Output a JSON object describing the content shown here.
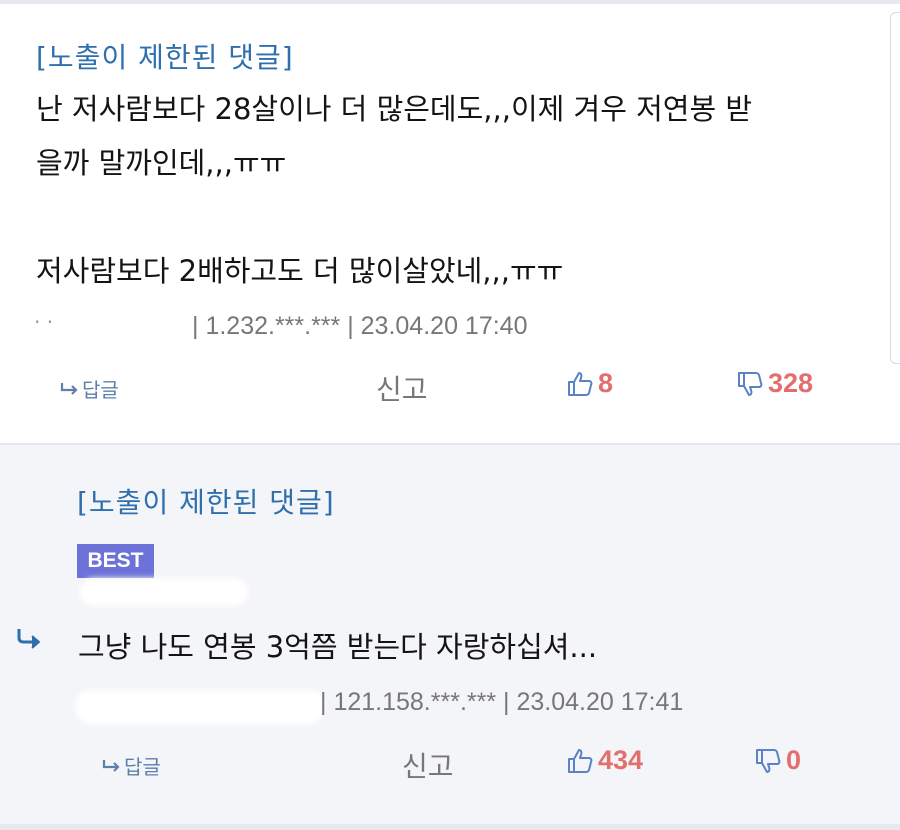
{
  "comments": [
    {
      "label": "[노출이 제한된 댓글]",
      "body_lines": [
        "난 저사람보다 28살이나 더 많은데도,,,이제 겨우 저연봉 받",
        "을까 말까인데,,,ㅠㅠ",
        "",
        "저사람보다 2배하고도 더 많이살았네,,,ㅠㅠ"
      ],
      "meta": "| 1.232.***.*** | 23.04.20 17:40",
      "reply_label": "답글",
      "report_label": "신고",
      "likes": "8",
      "dislikes": "328"
    },
    {
      "label": "[노출이 제한된 댓글]",
      "badge": "BEST",
      "body": "그냥 나도 연봉 3억쯤 받는다 자랑하십셔...",
      "meta": "| 121.158.***.*** | 23.04.20 17:41",
      "reply_label": "답글",
      "report_label": "신고",
      "likes": "434",
      "dislikes": "0"
    }
  ],
  "colors": {
    "link": "#2f6fad",
    "badge": "#6c72d8",
    "count": "#e36e6e",
    "thumb": "#5b82c6"
  },
  "icons": [
    "reply-arrow-icon",
    "thumbs-up-icon",
    "thumbs-down-icon"
  ]
}
